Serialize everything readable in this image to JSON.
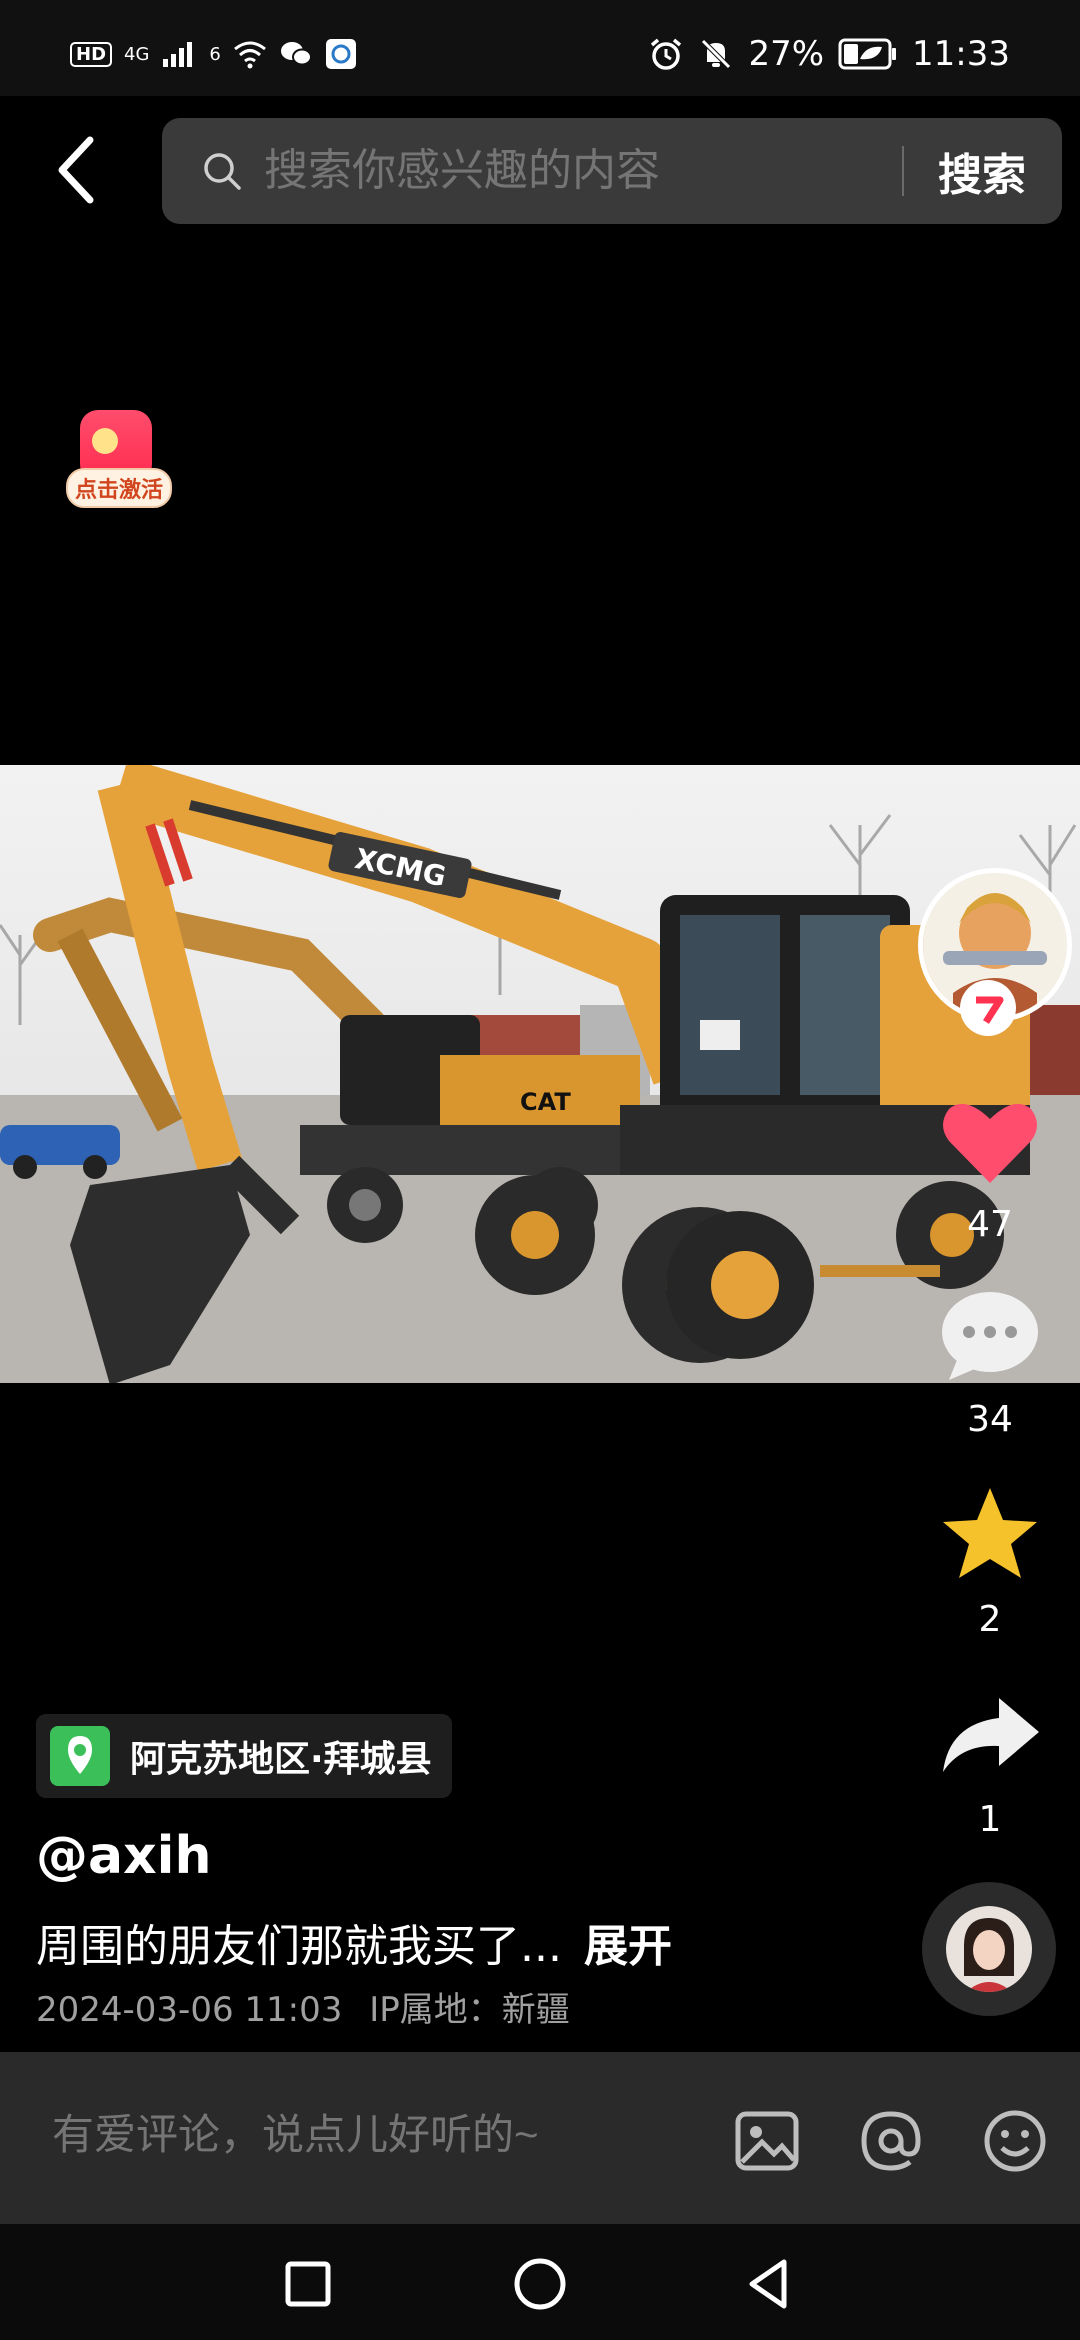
{
  "status_bar": {
    "hd": "HD",
    "network": "4G",
    "network_sub": "6",
    "battery": "27%",
    "time": "11:33"
  },
  "search": {
    "placeholder": "搜索你感兴趣的内容",
    "button": "搜索"
  },
  "red_packet": {
    "label": "点击激活"
  },
  "rail": {
    "likes": "47",
    "comments": "34",
    "favorites": "2",
    "shares": "1"
  },
  "post": {
    "location": "阿克苏地区·拜城县",
    "username": "@axih",
    "description": "周围的朋友们那就我买了...",
    "expand": "展开",
    "datetime": "2024-03-06 11:03",
    "ip_label": "IP属地：",
    "ip_region": "新疆"
  },
  "comment_bar": {
    "placeholder": "有爱评论，说点儿好听的~"
  },
  "photo_brands": {
    "brand1": "XCMG",
    "brand2": "CAT"
  },
  "colors": {
    "like": "#ff4d6d",
    "star": "#f6c22b",
    "location": "#3bbf58",
    "excavator": "#e6a23a"
  }
}
